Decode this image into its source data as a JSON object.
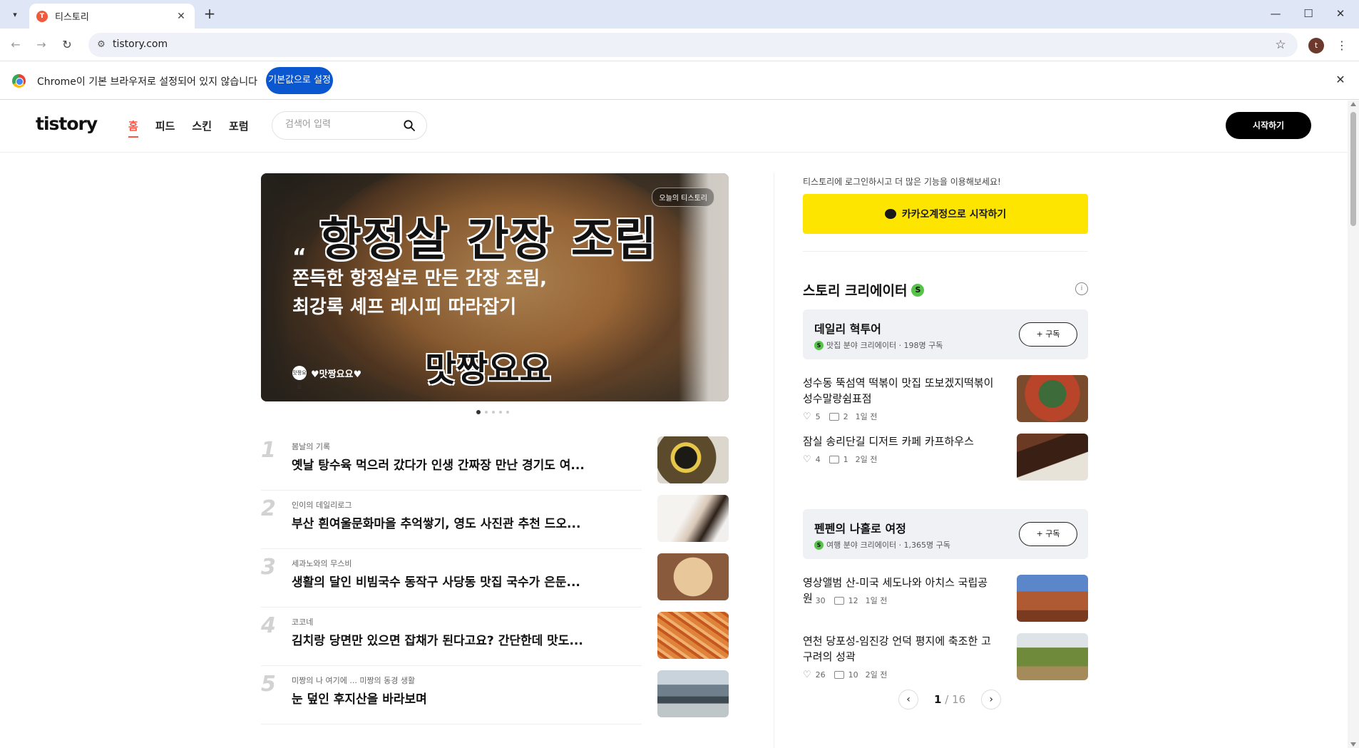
{
  "browser": {
    "tab_title": "티스토리",
    "tab_favicon": "T",
    "url": "tistory.com",
    "profile_initial": "t",
    "infobar_message": "Chrome이 기본 브라우저로 설정되어 있지 않습니다",
    "infobar_button": "기본값으로 설정"
  },
  "header": {
    "logo": "tistory",
    "nav": [
      "홈",
      "피드",
      "스킨",
      "포럼"
    ],
    "search_placeholder": "검색어 입력",
    "start_button": "시작하기"
  },
  "hero": {
    "big_title": "항정살 간장 조림",
    "badge": "오늘의 티스토리",
    "quote_mark": "“",
    "description": "쫀득한 항정살로 만든 간장 조림, 최강록 셰프 레시피 따라잡기",
    "brand_text": "맛짱요요",
    "author_avatar": "맛짱요요",
    "author": "♥맛짱요요♥",
    "slide_count": 5
  },
  "ranking": [
    {
      "num": "1",
      "category": "봄날의 기록",
      "title": "옛날 탕수육 먹으러 갔다가 인생 간짜장 만난 경기도 여...",
      "thumb_color": "#5b4a2c"
    },
    {
      "num": "2",
      "category": "인이의 데일리로그",
      "title": "부산 흰여울문화마을 추억쌓기, 영도 사진관 추천 드오...",
      "thumb_color": "#f2f0ee"
    },
    {
      "num": "3",
      "category": "세과노와의 무스비",
      "title": "생활의 달인 비빔국수 동작구 사당동 맛집 국수가 은둔...",
      "thumb_color": "#c9a477"
    },
    {
      "num": "4",
      "category": "코코네",
      "title": "김치랑 당면만 있으면 잡채가 된다고요? 간단한데 맛도...",
      "thumb_color": "#e0833a"
    },
    {
      "num": "5",
      "category": "미짱의 나 여기에 ... 미짱의 동경 생활",
      "title": "눈 덮인 후지산을 바라보며",
      "thumb_color": "#8ea3b5"
    }
  ],
  "sidebar": {
    "login_hint": "티스토리에 로그인하시고 더 많은 기능을 이용해보세요!",
    "kakao_button": "카카오계정으로 시작하기",
    "creator_heading": "스토리 크리에이터",
    "s_badge": "S",
    "info_icon": "i",
    "creators": [
      {
        "name": "데일리 혁투어",
        "meta": "맛집 분야 크리에이터 · 198명 구독",
        "subscribe": "+ 구독",
        "posts": [
          {
            "title": "성수동 뚝섬역 떡볶이 맛집 또보겠지떡볶이 성수말랑쉼표점",
            "likes": "5",
            "comments": "2",
            "time": "1일 전",
            "thumb_color": "#7a4b2c"
          },
          {
            "title": "잠실 송리단길 디저트 카페 카프하우스",
            "likes": "4",
            "comments": "1",
            "time": "2일 전",
            "thumb_color": "#4a2a1c"
          }
        ]
      },
      {
        "name": "펜펜의 나홀로 여정",
        "meta": "여행 분야 크리에이터 · 1,365명 구독",
        "subscribe": "+ 구독",
        "posts": [
          {
            "title": "영상앨범 산-미국 세도나와 아치스 국립공원",
            "likes": "30",
            "comments": "12",
            "time": "1일 전",
            "thumb_color": "#b05a33"
          },
          {
            "title": "연천 당포성-임진강 언덕 평지에 축조한 고구려의 성곽",
            "likes": "26",
            "comments": "10",
            "time": "2일 전",
            "thumb_color": "#6f8a3a"
          }
        ]
      }
    ],
    "pager": {
      "current": "1",
      "total": "16",
      "sep": "/"
    }
  },
  "colors": {
    "accent_red": "#ff5544",
    "kakao_yellow": "#fee500",
    "chrome_blue": "#0b57d0",
    "creator_green": "#58c34a"
  }
}
